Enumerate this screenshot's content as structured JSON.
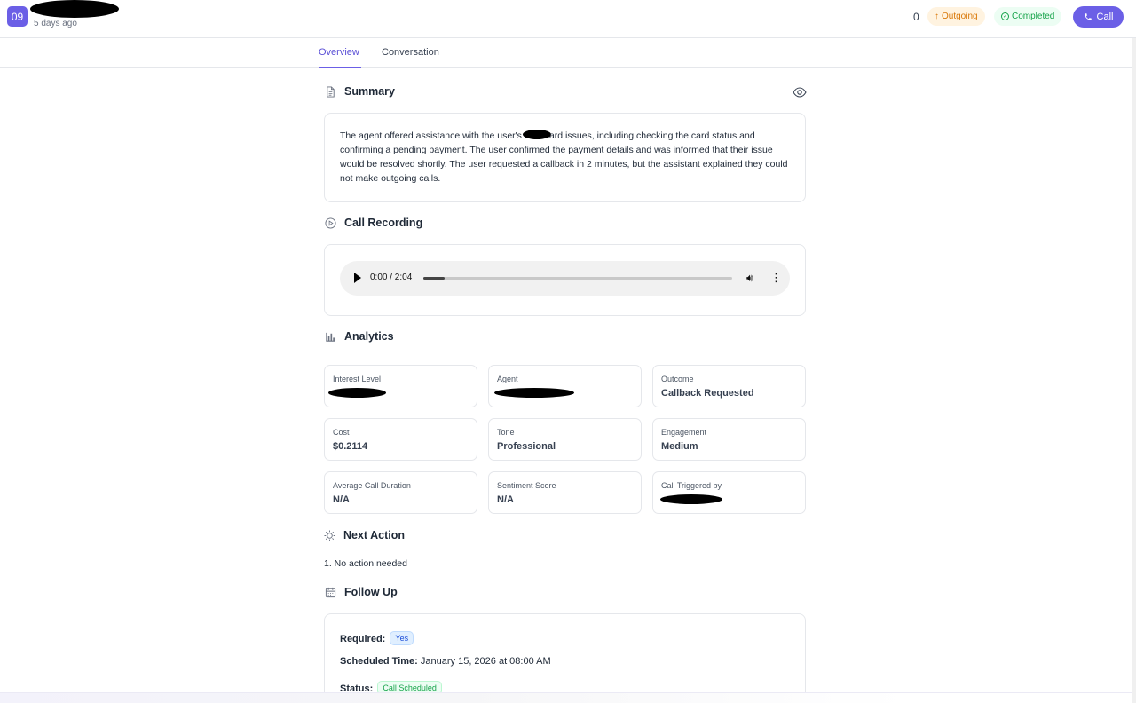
{
  "header": {
    "avatar_text": "09",
    "time_ago": "5 days ago",
    "count": "0",
    "direction_label": "Outgoing",
    "status_label": "Completed",
    "call_button_label": "Call",
    "accent_color": "#6b5fe6"
  },
  "tabs": [
    {
      "label": "Overview",
      "active": true
    },
    {
      "label": "Conversation",
      "active": false
    }
  ],
  "summary": {
    "title": "Summary",
    "text_before": "The agent offered assistance with the user's",
    "text_after": "ard issues, including checking the card status and confirming a pending payment. The user confirmed the payment details and was informed that their issue would be resolved shortly. The user requested a callback in 2 minutes, but the assistant explained they could not make outgoing calls."
  },
  "recording": {
    "title": "Call Recording",
    "time": "0:00 / 2:04",
    "progress": 0.07
  },
  "analytics": {
    "title": "Analytics",
    "stats": [
      {
        "label": "Interest Level",
        "value": ""
      },
      {
        "label": "Agent",
        "value": ""
      },
      {
        "label": "Outcome",
        "value": "Callback Requested"
      },
      {
        "label": "Cost",
        "value": "$0.2114"
      },
      {
        "label": "Tone",
        "value": "Professional"
      },
      {
        "label": "Engagement",
        "value": "Medium"
      },
      {
        "label": "Average Call Duration",
        "value": "N/A"
      },
      {
        "label": "Sentiment Score",
        "value": "N/A"
      },
      {
        "label": "Call Triggered by",
        "value": ""
      }
    ]
  },
  "next_action": {
    "title": "Next Action",
    "items": [
      "1. No action needed"
    ]
  },
  "follow_up": {
    "title": "Follow Up",
    "required_label": "Required:",
    "required_value": "Yes",
    "scheduled_label": "Scheduled Time:",
    "scheduled_value": "January 15, 2026 at 08:00 AM",
    "status_label": "Status:",
    "status_value": "Call Scheduled"
  }
}
